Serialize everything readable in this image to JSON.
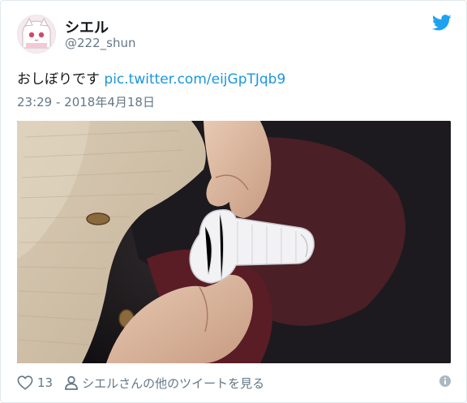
{
  "user": {
    "display_name": "シエル",
    "handle": "@222_shun",
    "avatar_icon": "anime-avatar-icon"
  },
  "tweet": {
    "text": "おしぼりです",
    "link": "pic.twitter.com/eijGpTJqb9",
    "timestamp": "23:29 - 2018年4月18日"
  },
  "media": {
    "description": "photo"
  },
  "footer": {
    "like_count": "13",
    "more_tweets_label": "シエルさんの他のツイートを見る"
  },
  "colors": {
    "link": "#1b95e0",
    "twitter_blue": "#1da1f2",
    "secondary_text": "#657786"
  }
}
